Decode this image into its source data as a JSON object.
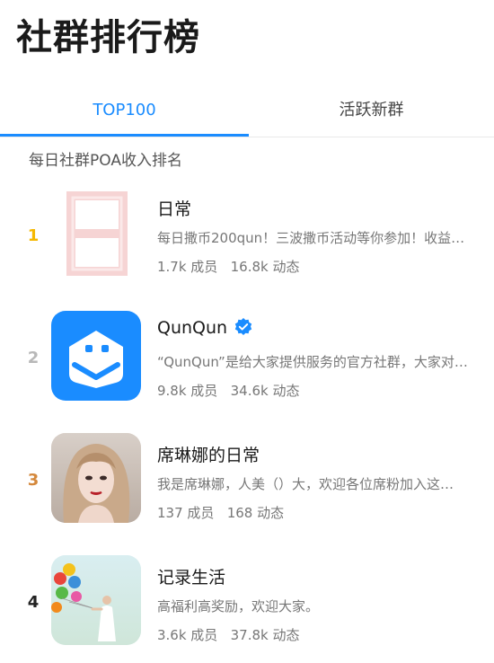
{
  "header": {
    "title": "社群排行榜"
  },
  "tabs": [
    {
      "label": "TOP100",
      "active": true
    },
    {
      "label": "活跃新群",
      "active": false
    }
  ],
  "subtitle": "每日社群POA收入排名",
  "colors": {
    "accent": "#1a8cff",
    "rank1": "#f5b800",
    "rank2": "#b8b8b8",
    "rank3": "#d4883c",
    "rank4": "#222222"
  },
  "groups": [
    {
      "rank": "1",
      "name": "日常",
      "description": "每日撒币200qun！三波撒币活动等你参加！收益…",
      "members": "1.7k 成员",
      "posts": "16.8k 动态",
      "avatar_icon": "character-ri-icon",
      "verified": false
    },
    {
      "rank": "2",
      "name": "QunQun",
      "description": "“QunQun”是给大家提供服务的官方社群，大家对…",
      "members": "9.8k 成员",
      "posts": "34.6k 动态",
      "avatar_icon": "qunqun-logo-icon",
      "verified": true
    },
    {
      "rank": "3",
      "name": "席琳娜的日常",
      "description": "我是席琳娜，人美（）大，欢迎各位席粉加入这…",
      "members": "137 成员",
      "posts": "168 动态",
      "avatar_icon": "woman-portrait-icon",
      "verified": false
    },
    {
      "rank": "4",
      "name": "记录生活",
      "description": "高福利高奖励，欢迎大家。",
      "members": "3.6k 成员",
      "posts": "37.8k 动态",
      "avatar_icon": "balloons-photo-icon",
      "verified": false
    }
  ]
}
